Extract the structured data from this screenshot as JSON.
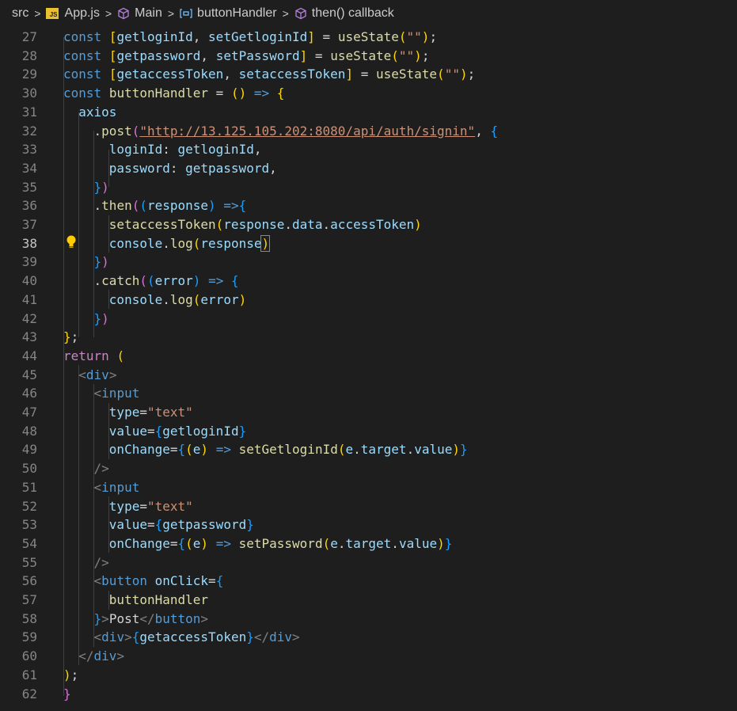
{
  "breadcrumb": {
    "items": [
      {
        "label": "src",
        "icon": "none"
      },
      {
        "label": "App.js",
        "icon": "js-file-icon"
      },
      {
        "label": "Main",
        "icon": "cube-icon"
      },
      {
        "label": "buttonHandler",
        "icon": "variable-bracket-icon"
      },
      {
        "label": "then() callback",
        "icon": "cube-icon"
      }
    ],
    "separator": ">"
  },
  "editor": {
    "active_line": 38,
    "lightbulb_line": 38,
    "colors": {
      "background": "#1e1e1e",
      "keyword": "#569cd6",
      "control": "#c586c0",
      "variable": "#9cdcfe",
      "function": "#dcdcaa",
      "string": "#ce9178",
      "bracket_gold": "#ffd700",
      "bracket_purple": "#da70d6",
      "bracket_blue": "#179fff"
    },
    "lines": [
      {
        "n": "27",
        "t": [
          [
            "kw",
            "const"
          ],
          [
            "pl",
            " "
          ],
          [
            "br1",
            "["
          ],
          [
            "var",
            "getloginId"
          ],
          [
            "pl",
            ", "
          ],
          [
            "var",
            "setGetloginId"
          ],
          [
            "br1",
            "]"
          ],
          [
            "pl",
            " = "
          ],
          [
            "fn",
            "useState"
          ],
          [
            "br1",
            "("
          ],
          [
            "str",
            "\"\""
          ],
          [
            "br1",
            ")"
          ],
          [
            "pl",
            ";"
          ]
        ]
      },
      {
        "n": "28",
        "t": [
          [
            "kw",
            "const"
          ],
          [
            "pl",
            " "
          ],
          [
            "br1",
            "["
          ],
          [
            "var",
            "getpassword"
          ],
          [
            "pl",
            ", "
          ],
          [
            "var",
            "setPassword"
          ],
          [
            "br1",
            "]"
          ],
          [
            "pl",
            " = "
          ],
          [
            "fn",
            "useState"
          ],
          [
            "br1",
            "("
          ],
          [
            "str",
            "\"\""
          ],
          [
            "br1",
            ")"
          ],
          [
            "pl",
            ";"
          ]
        ]
      },
      {
        "n": "29",
        "t": [
          [
            "kw",
            "const"
          ],
          [
            "pl",
            " "
          ],
          [
            "br1",
            "["
          ],
          [
            "var",
            "getaccessToken"
          ],
          [
            "pl",
            ", "
          ],
          [
            "var",
            "setaccessToken"
          ],
          [
            "br1",
            "]"
          ],
          [
            "pl",
            " = "
          ],
          [
            "fn",
            "useState"
          ],
          [
            "br1",
            "("
          ],
          [
            "str",
            "\"\""
          ],
          [
            "br1",
            ")"
          ],
          [
            "pl",
            ";"
          ]
        ]
      },
      {
        "n": "30",
        "t": [
          [
            "kw",
            "const"
          ],
          [
            "pl",
            " "
          ],
          [
            "fn",
            "buttonHandler"
          ],
          [
            "pl",
            " = "
          ],
          [
            "br1",
            "()"
          ],
          [
            "pl",
            " "
          ],
          [
            "kw",
            "=>"
          ],
          [
            "pl",
            " "
          ],
          [
            "br1",
            "{"
          ]
        ]
      },
      {
        "n": "31",
        "t": [
          [
            "pl",
            "  "
          ],
          [
            "var",
            "axios"
          ]
        ]
      },
      {
        "n": "32",
        "t": [
          [
            "pl",
            "    ."
          ],
          [
            "fn",
            "post"
          ],
          [
            "br2",
            "("
          ],
          [
            "url",
            "\"http://13.125.105.202:8080/api/auth/signin\""
          ],
          [
            "pl",
            ", "
          ],
          [
            "br3",
            "{"
          ]
        ]
      },
      {
        "n": "33",
        "t": [
          [
            "pl",
            "      "
          ],
          [
            "var",
            "loginId"
          ],
          [
            "pl",
            ": "
          ],
          [
            "var",
            "getloginId"
          ],
          [
            "pl",
            ","
          ]
        ]
      },
      {
        "n": "34",
        "t": [
          [
            "pl",
            "      "
          ],
          [
            "var",
            "password"
          ],
          [
            "pl",
            ": "
          ],
          [
            "var",
            "getpassword"
          ],
          [
            "pl",
            ","
          ]
        ]
      },
      {
        "n": "35",
        "t": [
          [
            "pl",
            "    "
          ],
          [
            "br3",
            "}"
          ],
          [
            "br2",
            ")"
          ]
        ]
      },
      {
        "n": "36",
        "t": [
          [
            "pl",
            "    ."
          ],
          [
            "fn",
            "then"
          ],
          [
            "br2",
            "("
          ],
          [
            "br3",
            "("
          ],
          [
            "var",
            "response"
          ],
          [
            "br3",
            ")"
          ],
          [
            "pl",
            " "
          ],
          [
            "kw",
            "=>"
          ],
          [
            "br3",
            "{"
          ]
        ]
      },
      {
        "n": "37",
        "t": [
          [
            "pl",
            "      "
          ],
          [
            "fn",
            "setaccessToken"
          ],
          [
            "br1",
            "("
          ],
          [
            "var",
            "response"
          ],
          [
            "pl",
            "."
          ],
          [
            "var",
            "data"
          ],
          [
            "pl",
            "."
          ],
          [
            "var",
            "accessToken"
          ],
          [
            "br1",
            ")"
          ]
        ]
      },
      {
        "n": "38",
        "t": [
          [
            "pl",
            "      "
          ],
          [
            "var",
            "console"
          ],
          [
            "pl",
            "."
          ],
          [
            "fn",
            "log"
          ],
          [
            "br1",
            "("
          ],
          [
            "var",
            "response"
          ],
          [
            "br1",
            ")"
          ]
        ]
      },
      {
        "n": "39",
        "t": [
          [
            "pl",
            "    "
          ],
          [
            "br3",
            "}"
          ],
          [
            "br2",
            ")"
          ]
        ]
      },
      {
        "n": "40",
        "t": [
          [
            "pl",
            "    ."
          ],
          [
            "fn",
            "catch"
          ],
          [
            "br2",
            "("
          ],
          [
            "br3",
            "("
          ],
          [
            "var",
            "error"
          ],
          [
            "br3",
            ")"
          ],
          [
            "pl",
            " "
          ],
          [
            "kw",
            "=>"
          ],
          [
            "pl",
            " "
          ],
          [
            "br3",
            "{"
          ]
        ]
      },
      {
        "n": "41",
        "t": [
          [
            "pl",
            "      "
          ],
          [
            "var",
            "console"
          ],
          [
            "pl",
            "."
          ],
          [
            "fn",
            "log"
          ],
          [
            "br1",
            "("
          ],
          [
            "var",
            "error"
          ],
          [
            "br1",
            ")"
          ]
        ]
      },
      {
        "n": "42",
        "t": [
          [
            "pl",
            "    "
          ],
          [
            "br3",
            "}"
          ],
          [
            "br2",
            ")"
          ]
        ]
      },
      {
        "n": "43",
        "t": [
          [
            "br1",
            "}"
          ],
          [
            "pl",
            ";"
          ]
        ]
      },
      {
        "n": "44",
        "t": [
          [
            "ctl",
            "return"
          ],
          [
            "pl",
            " "
          ],
          [
            "br1",
            "("
          ]
        ]
      },
      {
        "n": "45",
        "t": [
          [
            "pl",
            "  "
          ],
          [
            "tagp",
            "<"
          ],
          [
            "tag",
            "div"
          ],
          [
            "tagp",
            ">"
          ]
        ]
      },
      {
        "n": "46",
        "t": [
          [
            "pl",
            "    "
          ],
          [
            "tagp",
            "<"
          ],
          [
            "tag",
            "input"
          ]
        ]
      },
      {
        "n": "47",
        "t": [
          [
            "pl",
            "      "
          ],
          [
            "attr",
            "type"
          ],
          [
            "pl",
            "="
          ],
          [
            "str",
            "\"text\""
          ]
        ]
      },
      {
        "n": "48",
        "t": [
          [
            "pl",
            "      "
          ],
          [
            "attr",
            "value"
          ],
          [
            "pl",
            "="
          ],
          [
            "br3",
            "{"
          ],
          [
            "var",
            "getloginId"
          ],
          [
            "br3",
            "}"
          ]
        ]
      },
      {
        "n": "49",
        "t": [
          [
            "pl",
            "      "
          ],
          [
            "attr",
            "onChange"
          ],
          [
            "pl",
            "="
          ],
          [
            "br3",
            "{"
          ],
          [
            "br1",
            "("
          ],
          [
            "var",
            "e"
          ],
          [
            "br1",
            ")"
          ],
          [
            "pl",
            " "
          ],
          [
            "kw",
            "=>"
          ],
          [
            "pl",
            " "
          ],
          [
            "fn",
            "setGetloginId"
          ],
          [
            "br1",
            "("
          ],
          [
            "var",
            "e"
          ],
          [
            "pl",
            "."
          ],
          [
            "var",
            "target"
          ],
          [
            "pl",
            "."
          ],
          [
            "var",
            "value"
          ],
          [
            "br1",
            ")"
          ],
          [
            "br3",
            "}"
          ]
        ]
      },
      {
        "n": "50",
        "t": [
          [
            "pl",
            "    "
          ],
          [
            "tagp",
            "/>"
          ]
        ]
      },
      {
        "n": "51",
        "t": [
          [
            "pl",
            "    "
          ],
          [
            "tagp",
            "<"
          ],
          [
            "tag",
            "input"
          ]
        ]
      },
      {
        "n": "52",
        "t": [
          [
            "pl",
            "      "
          ],
          [
            "attr",
            "type"
          ],
          [
            "pl",
            "="
          ],
          [
            "str",
            "\"text\""
          ]
        ]
      },
      {
        "n": "53",
        "t": [
          [
            "pl",
            "      "
          ],
          [
            "attr",
            "value"
          ],
          [
            "pl",
            "="
          ],
          [
            "br3",
            "{"
          ],
          [
            "var",
            "getpassword"
          ],
          [
            "br3",
            "}"
          ]
        ]
      },
      {
        "n": "54",
        "t": [
          [
            "pl",
            "      "
          ],
          [
            "attr",
            "onChange"
          ],
          [
            "pl",
            "="
          ],
          [
            "br3",
            "{"
          ],
          [
            "br1",
            "("
          ],
          [
            "var",
            "e"
          ],
          [
            "br1",
            ")"
          ],
          [
            "pl",
            " "
          ],
          [
            "kw",
            "=>"
          ],
          [
            "pl",
            " "
          ],
          [
            "fn",
            "setPassword"
          ],
          [
            "br1",
            "("
          ],
          [
            "var",
            "e"
          ],
          [
            "pl",
            "."
          ],
          [
            "var",
            "target"
          ],
          [
            "pl",
            "."
          ],
          [
            "var",
            "value"
          ],
          [
            "br1",
            ")"
          ],
          [
            "br3",
            "}"
          ]
        ]
      },
      {
        "n": "55",
        "t": [
          [
            "pl",
            "    "
          ],
          [
            "tagp",
            "/>"
          ]
        ]
      },
      {
        "n": "56",
        "t": [
          [
            "pl",
            "    "
          ],
          [
            "tagp",
            "<"
          ],
          [
            "tag",
            "button"
          ],
          [
            "pl",
            " "
          ],
          [
            "attr",
            "onClick"
          ],
          [
            "pl",
            "="
          ],
          [
            "br3",
            "{"
          ]
        ]
      },
      {
        "n": "57",
        "t": [
          [
            "pl",
            "      "
          ],
          [
            "fn",
            "buttonHandler"
          ]
        ]
      },
      {
        "n": "58",
        "t": [
          [
            "pl",
            "    "
          ],
          [
            "br3",
            "}"
          ],
          [
            "tagp",
            ">"
          ],
          [
            "pl",
            "Post"
          ],
          [
            "tagp",
            "</"
          ],
          [
            "tag",
            "button"
          ],
          [
            "tagp",
            ">"
          ]
        ]
      },
      {
        "n": "59",
        "t": [
          [
            "pl",
            "    "
          ],
          [
            "tagp",
            "<"
          ],
          [
            "tag",
            "div"
          ],
          [
            "tagp",
            ">"
          ],
          [
            "br3",
            "{"
          ],
          [
            "var",
            "getaccessToken"
          ],
          [
            "br3",
            "}"
          ],
          [
            "tagp",
            "</"
          ],
          [
            "tag",
            "div"
          ],
          [
            "tagp",
            ">"
          ]
        ]
      },
      {
        "n": "60",
        "t": [
          [
            "pl",
            "  "
          ],
          [
            "tagp",
            "</"
          ],
          [
            "tag",
            "div"
          ],
          [
            "tagp",
            ">"
          ]
        ]
      },
      {
        "n": "61",
        "t": [
          [
            "br1",
            ")"
          ],
          [
            "pl",
            ";"
          ]
        ]
      },
      {
        "n": "62",
        "t": [
          [
            "br2",
            "}"
          ]
        ]
      }
    ]
  }
}
